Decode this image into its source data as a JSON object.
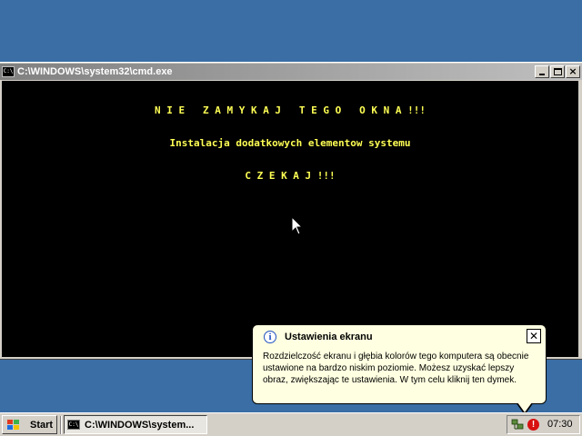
{
  "window": {
    "title": "C:\\WINDOWS\\system32\\cmd.exe",
    "icon_text": "C:\\"
  },
  "console": {
    "line1": "N I E   Z A M Y K A J   T E G O   O K N A !!!",
    "line2": "Instalacja dodatkowych elementow systemu",
    "line3": "C Z E K A J !!!",
    "text_color": "#ffff55",
    "background": "#000000"
  },
  "balloon": {
    "title": "Ustawienia ekranu",
    "close_glyph": "✕",
    "info_glyph": "i",
    "text": "Rozdzielczość ekranu i głębia kolorów tego komputera są obecnie ustawione na bardzo niskim poziomie. Możesz uzyskać lepszy obraz, zwiększając te ustawienia. W tym celu kliknij ten dymek."
  },
  "taskbar": {
    "start_label": "Start",
    "task_label": "C:\\WINDOWS\\system...",
    "clock": "07:30",
    "alert_glyph": "!"
  },
  "colors": {
    "desktop": "#3a6ea5",
    "balloon_bg": "#ffffe1",
    "alert": "#d81010"
  }
}
